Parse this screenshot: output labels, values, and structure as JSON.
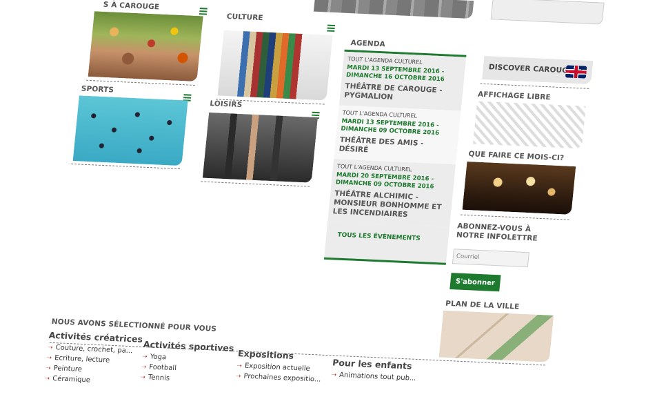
{
  "tiles": {
    "fete": {
      "title": "S À CAROUGE"
    },
    "culture": {
      "title": "CULTURE"
    },
    "sports": {
      "title": "SPORTS"
    },
    "loisirs": {
      "title": "LOISIRS"
    }
  },
  "agenda": {
    "title": "AGENDA",
    "items": [
      {
        "kicker": "TOUT L'AGENDA CULTUREL",
        "date": "MARDI 13 SEPTEMBRE 2016 - DIMANCHE 16 OCTOBRE 2016",
        "title": "THÉÂTRE DE CAROUGE - PYGMALION"
      },
      {
        "kicker": "TOUT L'AGENDA CULTUREL",
        "date": "MARDI 13 SEPTEMBRE 2016 - DIMANCHE 09 OCTOBRE 2016",
        "title": "THÉÂTRE DES AMIS - DÉSIRÉ"
      },
      {
        "kicker": "TOUT L'AGENDA CULTUREL",
        "date": "MARDI 20 SEPTEMBRE 2016 - DIMANCHE 09 OCTOBRE 2016",
        "title": "THÉÂTRE ALCHIMIC - MONSIEUR BONHOMME ET LES INCENDIAIRES"
      }
    ],
    "all_label": "TOUS LES ÉVÈNEMENTS"
  },
  "sidebar": {
    "discover": "DISCOVER CAROUGE",
    "affichage": "AFFICHAGE LIBRE",
    "que_faire": "QUE FAIRE CE MOIS-CI?",
    "newsletter_title": "ABONNEZ-VOUS À NOTRE INFOLETTRE",
    "email_placeholder": "Courriel",
    "subscribe_label": "S'abonner",
    "plan": "PLAN DE LA VILLE"
  },
  "selection": {
    "title": "NOUS AVONS SÉLECTIONNÉ POUR VOUS",
    "columns": [
      {
        "title": "Activités créatrices",
        "links": [
          "Couture, crochet, pa...",
          "Ecriture, lecture",
          "Peinture",
          "Céramique"
        ]
      },
      {
        "title": "Activités sportives",
        "links": [
          "Yoga",
          "Football",
          "Tennis"
        ]
      },
      {
        "title": "Expositions",
        "links": [
          "Exposition actuelle",
          "Prochaines expositio..."
        ]
      },
      {
        "title": "Pour les enfants",
        "links": [
          "Animations tout pub..."
        ]
      }
    ]
  },
  "colors": {
    "accent": "#1d7a2e",
    "arrow": "#c0392b"
  }
}
